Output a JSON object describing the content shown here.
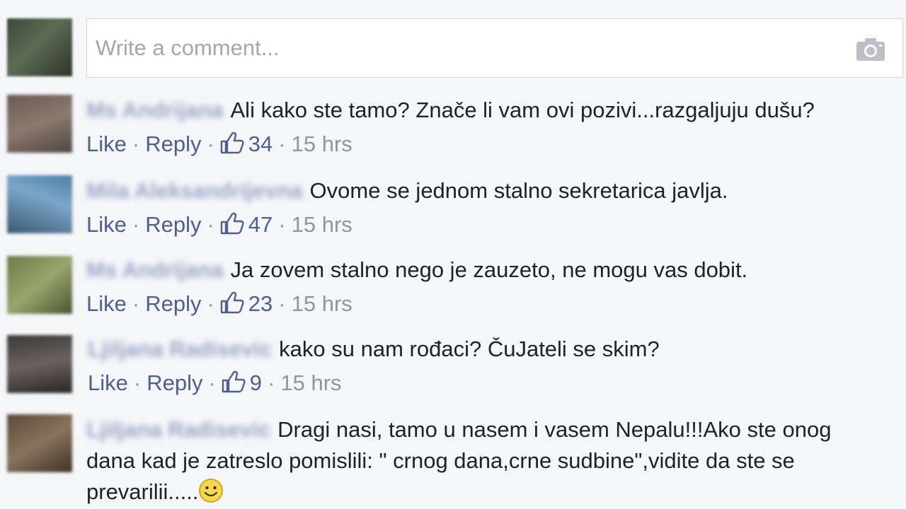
{
  "composer": {
    "placeholder": "Write a comment..."
  },
  "ui": {
    "like_label": "Like",
    "reply_label": "Reply",
    "separator": "·"
  },
  "comments": [
    {
      "author": "Ms Andrijana",
      "text": "Ali kako ste tamo? Znače li vam ovi pozivi...razgaljuju dušu?",
      "likes": "34",
      "time": "15 hrs"
    },
    {
      "author": "Mila Aleksandrijevna",
      "text": "Ovome se jednom stalno sekretarica javlja.",
      "likes": "47",
      "time": "15 hrs"
    },
    {
      "author": "Ms Andrijana",
      "text": "Ja zovem stalno nego je zauzeto, ne mogu vas dobit.",
      "likes": "23",
      "time": "15 hrs"
    },
    {
      "author": "Ljiljana Radisevic",
      "text": "kako su nam rođaci? ČuJateli se skim?",
      "likes": "9",
      "time": "15 hrs"
    },
    {
      "author": "Ljiljana Radisevic",
      "text": "Dragi nasi, tamo u nasem i vasem Nepalu!!!Ako ste onog dana kad je zatreslo pomislili: \" crnog dana,crne sudbine\",vidite da ste se prevarilii....."
    }
  ],
  "colors": {
    "link": "#4b5f92",
    "meta": "#90949c",
    "text": "#1d2129",
    "background": "#f5f6f8"
  },
  "icons": [
    "camera-icon",
    "thumbs-up-icon",
    "smiley-icon"
  ]
}
